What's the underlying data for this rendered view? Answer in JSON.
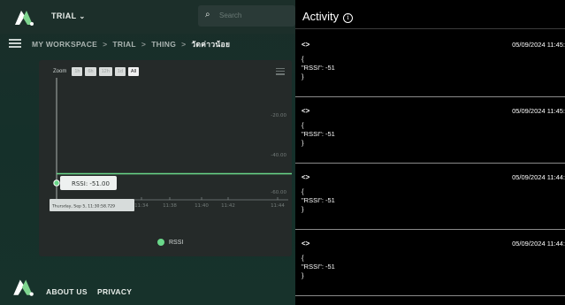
{
  "header": {
    "workspace_label": "TRIAL",
    "search_placeholder": "Search"
  },
  "breadcrumb": {
    "items": [
      "MY WORKSPACE",
      "TRIAL",
      "THING",
      "วัดค่าวน้อย"
    ],
    "separator": ">"
  },
  "chart": {
    "zoom_label": "Zoom",
    "zoom_buttons": [
      "1h",
      "6h",
      "12h",
      "1d",
      "All"
    ],
    "active_zoom": "All",
    "tooltip_value": "RSSI: -51.00",
    "tooltip_time": "Thursday, Sep 5, 11:30:58.729",
    "legend_label": "RSSI",
    "series_color": "#6ad88a"
  },
  "chart_data": {
    "type": "line",
    "series": [
      {
        "name": "RSSI",
        "values": [
          -51,
          -51,
          -51,
          -51,
          -51
        ]
      }
    ],
    "x": [
      "11:30:58",
      "11:34",
      "11:38",
      "11:40",
      "11:42",
      "11:44"
    ],
    "x_tick_labels": [
      "11:34",
      "11:38",
      "11:40",
      "11:42",
      "11:44"
    ],
    "y_tick_labels": [
      "-20.00",
      "-40.00",
      "-60.00"
    ],
    "ylim": [
      -60,
      -20
    ]
  },
  "footer": {
    "about_label": "ABOUT US",
    "privacy_label": "PRIVACY"
  },
  "activity": {
    "title": "Activity",
    "entries": [
      {
        "code": "<>",
        "time": "05/09/2024 11:45:",
        "line1": "{",
        "line2": "\"RSSI\": -51",
        "line3": "}"
      },
      {
        "code": "<>",
        "time": "05/09/2024 11:45:",
        "line1": "{",
        "line2": "\"RSSI\": -51",
        "line3": "}"
      },
      {
        "code": "<>",
        "time": "05/09/2024 11:44:",
        "line1": "{",
        "line2": "\"RSSI\": -51",
        "line3": "}"
      },
      {
        "code": "<>",
        "time": "05/09/2024 11:44:",
        "line1": "{",
        "line2": "\"RSSI\": -51",
        "line3": "}"
      }
    ]
  }
}
